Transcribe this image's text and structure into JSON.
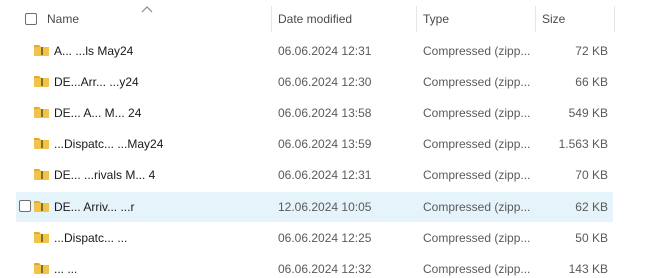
{
  "header": {
    "name": "Name",
    "date_modified": "Date modified",
    "type": "Type",
    "size": "Size"
  },
  "icons": {
    "sort": "sort-ascending-icon",
    "folder": "zip-folder-icon"
  },
  "colors": {
    "selected_row": "#e5f3fb",
    "folder_body": "#f0c34a",
    "folder_tab": "#e2a92b"
  },
  "files": [
    {
      "name": "A...  ...ls May24",
      "date": "06.06.2024 12:31",
      "type": "Compressed (zipp...",
      "size": "72 KB",
      "selected": false
    },
    {
      "name": "DE...Arr...  ...y24",
      "date": "06.06.2024 12:30",
      "type": "Compressed (zipp...",
      "size": "66 KB",
      "selected": false
    },
    {
      "name": "DE... A...  M... 24",
      "date": "06.06.2024 13:58",
      "type": "Compressed (zipp...",
      "size": "549 KB",
      "selected": false
    },
    {
      "name": "...Dispatc...  ...May24",
      "date": "06.06.2024 13:59",
      "type": "Compressed (zipp...",
      "size": "1.563 KB",
      "selected": false
    },
    {
      "name": "DE... ...rivals M... 4",
      "date": "06.06.2024 12:31",
      "type": "Compressed (zipp...",
      "size": "70 KB",
      "selected": false
    },
    {
      "name": "DE... Arriv...  ...r",
      "date": "12.06.2024 10:05",
      "type": "Compressed (zipp...",
      "size": "62 KB",
      "selected": true
    },
    {
      "name": "...Dispatc...  ...",
      "date": "06.06.2024 12:25",
      "type": "Compressed (zipp...",
      "size": "50 KB",
      "selected": false
    },
    {
      "name": "...  ...",
      "date": "06.06.2024 12:32",
      "type": "Compressed (zipp...",
      "size": "143 KB",
      "selected": false
    }
  ]
}
